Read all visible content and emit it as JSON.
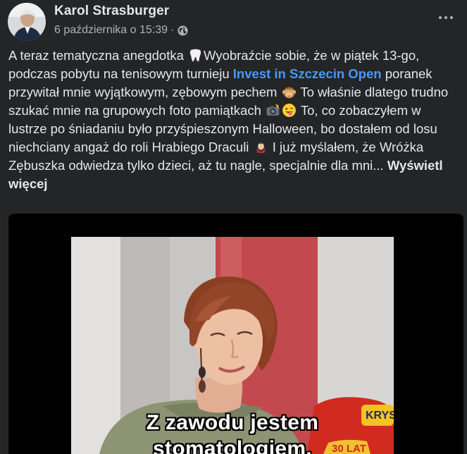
{
  "post": {
    "author": "Karol Strasburger",
    "date": "6 października o 15:39",
    "separator": "·",
    "icons": {
      "visibility": "globe-icon",
      "more": "more-options-icon"
    }
  },
  "text": {
    "seg1": "A teraz tematyczna anegdotka ",
    "seg2": "Wyobraźcie sobie, że w piątek 13-go, podczas pobytu na tenisowym turnieju ",
    "link": "Invest in Szczecin Open",
    "seg3": " poranek przywitał mnie wyjątkowym, zębowym pechem ",
    "seg4": " To właśnie dlatego trudno szukać mnie na grupowych foto pamiątkach ",
    "seg5": " To, co zobaczyłem w lustrze po śniadaniu było przyśpieszonym Halloween, bo dostałem od losu niechciany angaż do roli Hrabiego Draculi ",
    "seg6": " I już myślałem, że Wróżka Zębuszka odwiedza tylko dzieci, aż tu nagle, specjalnie dla mni... ",
    "see_more": "Wyświetl więcej",
    "link_color": "#4599ff"
  },
  "video": {
    "subtitle_line1": "Z zawodu jestem",
    "subtitle_line2": "stomatologiem.",
    "shirt_text": "KRYS",
    "badge_text": "30 LAT"
  },
  "colors": {
    "background": "#242526",
    "text": "#e4e6eb",
    "secondary": "#b0b3b8"
  }
}
